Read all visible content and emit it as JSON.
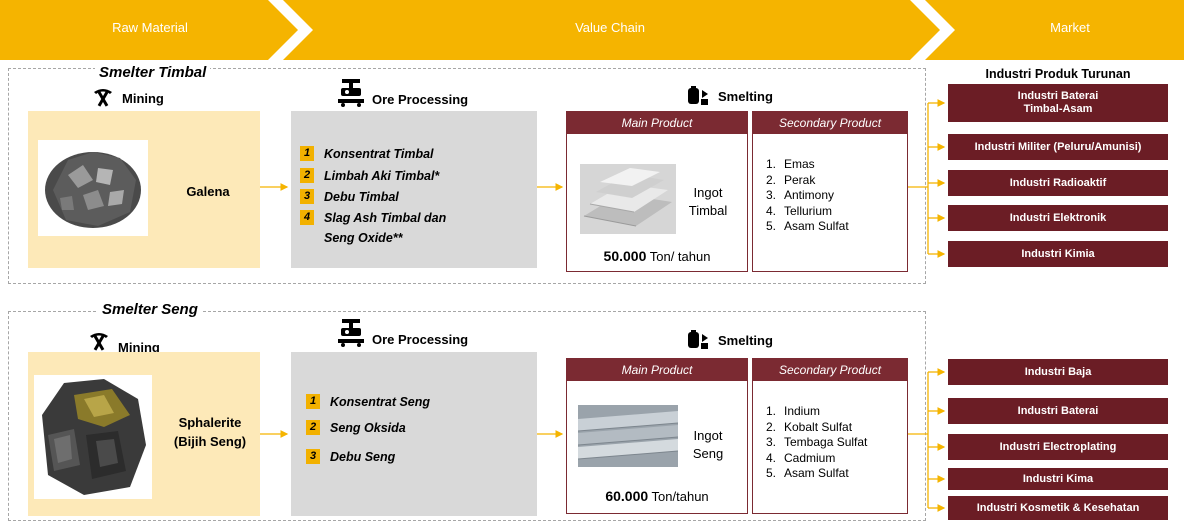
{
  "header": {
    "raw_material": "Raw Material",
    "value_chain": "Value Chain",
    "market": "Market"
  },
  "colors": {
    "chevron": "#f5b400",
    "maroon": "#6b1d25",
    "raw_bg": "#fde9b8",
    "ore_bg": "#d9d9d9"
  },
  "timbal": {
    "title": "Smelter Timbal",
    "mining_label": "Mining",
    "raw_name": "Galena",
    "ore_label": "Ore Processing",
    "ore_items": [
      {
        "num": "1",
        "text": "Konsentrat Timbal"
      },
      {
        "num": "2",
        "text": "Limbah Aki Timbal*"
      },
      {
        "num": "3",
        "text": "Debu Timbal"
      },
      {
        "num": "4",
        "text": "Slag Ash Timbal dan Seng Oxide**"
      }
    ],
    "smelting_label": "Smelting",
    "main_product_head": "Main Product",
    "ingot_line1": "Ingot",
    "ingot_line2": "Timbal",
    "capacity_value": "50.000",
    "capacity_unit": " Ton/ tahun",
    "secondary_head": "Secondary Product",
    "secondary": [
      {
        "num": "1.",
        "text": "Emas"
      },
      {
        "num": "2.",
        "text": "Perak"
      },
      {
        "num": "3.",
        "text": "Antimony"
      },
      {
        "num": "4.",
        "text": "Tellurium"
      },
      {
        "num": "5.",
        "text": "Asam Sulfat"
      }
    ]
  },
  "seng": {
    "title": "Smelter Seng",
    "mining_label": "Mining",
    "raw_name_line1": "Sphalerite",
    "raw_name_line2": "(Bijih Seng)",
    "ore_label": "Ore Processing",
    "ore_items": [
      {
        "num": "1",
        "text": "Konsentrat Seng"
      },
      {
        "num": "2",
        "text": "Seng Oksida"
      },
      {
        "num": "3",
        "text": "Debu Seng"
      }
    ],
    "smelting_label": "Smelting",
    "main_product_head": "Main Product",
    "ingot_line1": "Ingot",
    "ingot_line2": "Seng",
    "capacity_value": "60.000",
    "capacity_unit": " Ton/tahun",
    "secondary_head": "Secondary Product",
    "secondary": [
      {
        "num": "1.",
        "text": "Indium"
      },
      {
        "num": "2.",
        "text": "Kobalt Sulfat"
      },
      {
        "num": "3.",
        "text": "Tembaga Sulfat"
      },
      {
        "num": "4.",
        "text": "Cadmium"
      },
      {
        "num": "5.",
        "text": "Asam Sulfat"
      }
    ]
  },
  "market": {
    "title": "Industri Produk Turunan",
    "timbal_items": [
      {
        "line1": "Industri Baterai",
        "line2": "Timbal-Asam"
      },
      {
        "line1": "Industri Militer (Peluru/Amunisi)",
        "line2": ""
      },
      {
        "line1": "Industri Radioaktif",
        "line2": ""
      },
      {
        "line1": "Industri Elektronik",
        "line2": ""
      },
      {
        "line1": "Industri Kimia",
        "line2": ""
      }
    ],
    "seng_items": [
      {
        "line1": "Industri Baja"
      },
      {
        "line1": "Industri Baterai"
      },
      {
        "line1": "Industri Electroplating"
      },
      {
        "line1": "Industri Kima"
      },
      {
        "line1": "Industri Kosmetik & Kesehatan"
      }
    ]
  }
}
